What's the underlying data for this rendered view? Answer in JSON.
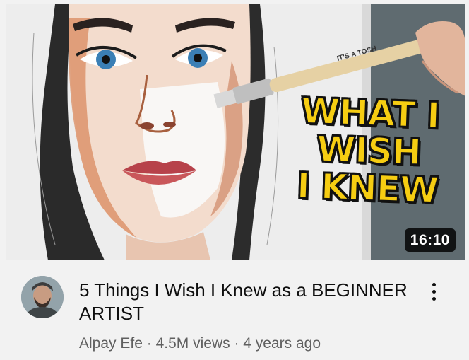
{
  "thumbnail": {
    "overlay_lines": [
      "WHAT I",
      "WISH",
      "I KNEW"
    ],
    "brush_brand": "IT'S A TOSH",
    "duration": "16:10",
    "overlay_color": "#f6cd12"
  },
  "video": {
    "title": "5 Things I Wish I Knew as a BEGINNER ARTIST",
    "channel": "Alpay Efe",
    "separator": "·",
    "views": "4.5M views",
    "age": "4 years ago"
  },
  "icons": {
    "more": "more-vert-icon",
    "avatar": "channel-avatar"
  }
}
